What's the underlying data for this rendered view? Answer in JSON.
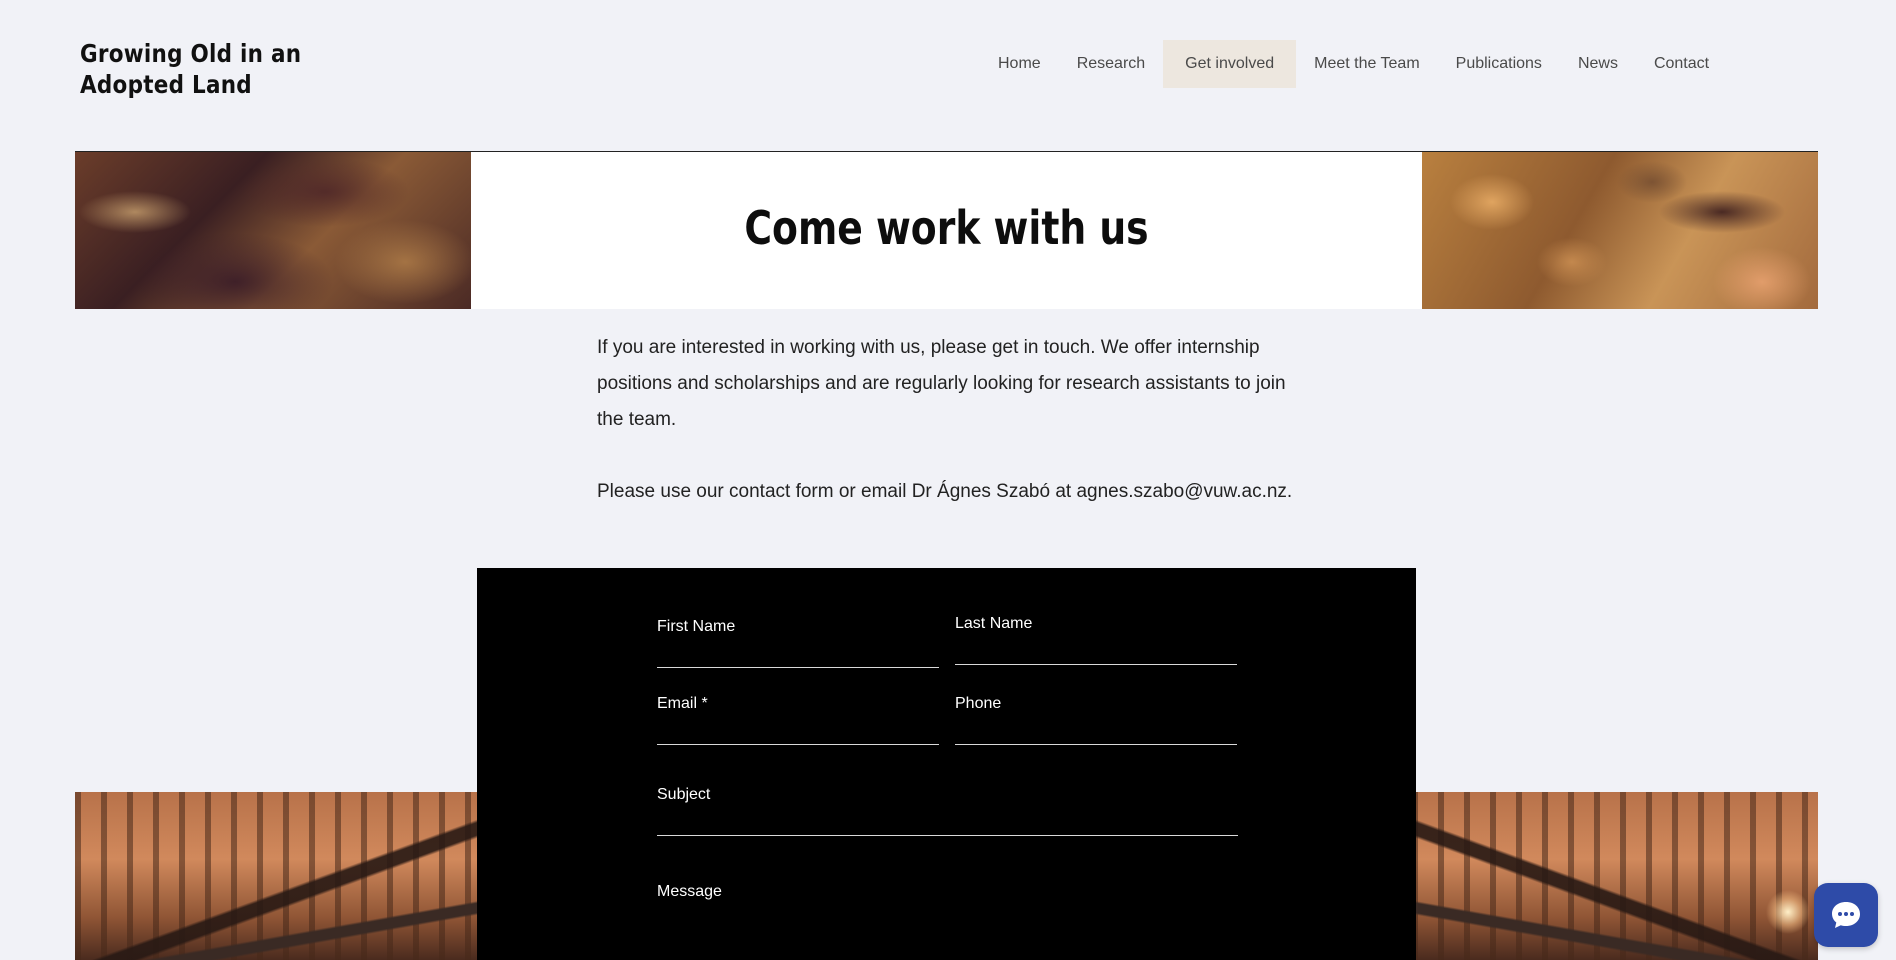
{
  "header": {
    "site_title_line1": "Growing Old in an",
    "site_title_line2": "Adopted Land"
  },
  "nav": {
    "items": [
      {
        "label": "Home"
      },
      {
        "label": "Research"
      },
      {
        "label": "Get involved"
      },
      {
        "label": "Meet the Team"
      },
      {
        "label": "Publications"
      },
      {
        "label": "News"
      },
      {
        "label": "Contact"
      }
    ],
    "active_index": 2
  },
  "hero": {
    "title": "Come work with us"
  },
  "intro": {
    "paragraph1": "If you are interested in working with us, please get in touch. We offer internship positions and scholarships and are regularly looking for research assistants to join the team.",
    "paragraph2": "Please use our contact form or email Dr Ágnes Szabó at agnes.szabo@vuw.ac.nz."
  },
  "form": {
    "first_name_label": "First Name",
    "last_name_label": "Last Name",
    "email_label": "Email *",
    "phone_label": "Phone",
    "subject_label": "Subject",
    "message_label": "Message"
  },
  "colors": {
    "page_background": "#f1f2f7",
    "nav_active_background": "#ede7df",
    "form_background": "#000000",
    "chat_button": "#2e4ba8"
  },
  "icons": {
    "chat_button": "chat-bubble-icon"
  }
}
